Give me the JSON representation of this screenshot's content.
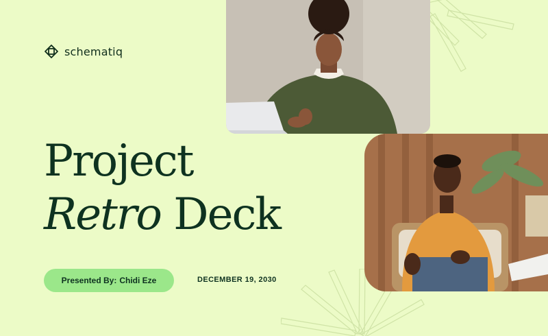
{
  "brand": {
    "name": "schematiq",
    "logo_icon": "diamond-logo-icon"
  },
  "title": {
    "line1": "Project",
    "line2_italic": "Retro",
    "line2_rest": "Deck"
  },
  "presenter": {
    "label": "Presented By:",
    "name": "Chidi Eze"
  },
  "date": "DECEMBER 19, 2030",
  "images": {
    "top": "photo-woman-with-laptop",
    "bottom": "photo-man-seated-in-chair"
  },
  "colors": {
    "background": "#ECFBC7",
    "title_text": "#0E3220",
    "pill": "#9BE78A"
  }
}
